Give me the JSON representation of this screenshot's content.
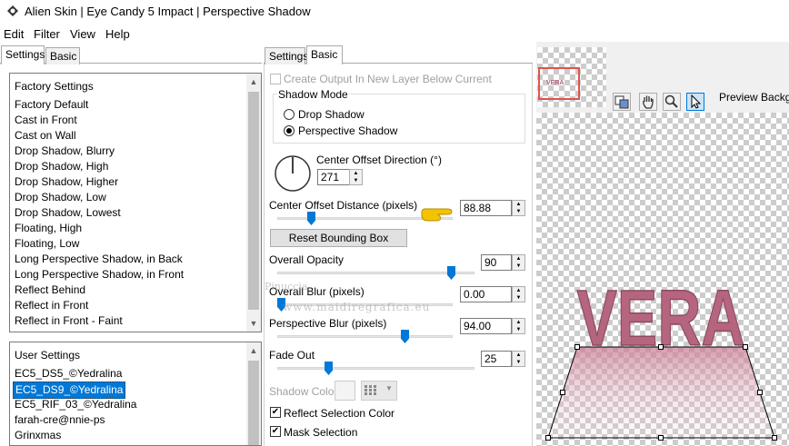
{
  "window": {
    "title": "Alien Skin | Eye Candy 5 Impact | Perspective Shadow"
  },
  "menu": [
    "Edit",
    "Filter",
    "View",
    "Help"
  ],
  "left_tabs": {
    "settings": "Settings",
    "basic": "Basic"
  },
  "factory": {
    "header": "Factory Settings",
    "items": [
      "Factory Default",
      "Cast in Front",
      "Cast on Wall",
      "Drop Shadow, Blurry",
      "Drop Shadow, High",
      "Drop Shadow, Higher",
      "Drop Shadow, Low",
      "Drop Shadow, Lowest",
      "Floating, High",
      "Floating, Low",
      "Long Perspective Shadow, in Back",
      "Long Perspective Shadow, in Front",
      "Reflect Behind",
      "Reflect in Front",
      "Reflect in Front - Faint"
    ]
  },
  "user": {
    "header": "User Settings",
    "items": [
      "EC5_DS5_©Yedralina",
      "EC5_DS9_©Yedralina",
      "EC5_RIF_03_©Yedralina",
      "farah-cre@nnie-ps",
      "Grinxmas"
    ],
    "selected_index": 1
  },
  "mid_tabs": {
    "settings": "Settings",
    "basic": "Basic"
  },
  "controls": {
    "create_output": "Create Output In New Layer Below Current",
    "shadow_mode_label": "Shadow Mode",
    "drop_shadow": "Drop Shadow",
    "perspective_shadow": "Perspective Shadow",
    "shadow_mode_selected": "Perspective Shadow",
    "center_offset_direction_label": "Center Offset Direction (°)",
    "center_offset_direction_value": "271",
    "center_offset_distance_label": "Center Offset Distance (pixels)",
    "center_offset_distance_value": "88.88",
    "center_offset_distance_fraction": 0.18,
    "reset_bounding_box": "Reset Bounding Box",
    "overall_opacity_label": "Overall Opacity",
    "overall_opacity_value": "90",
    "overall_opacity_fraction": 0.9,
    "overall_blur_label": "Overall Blur (pixels)",
    "overall_blur_value": "0.00",
    "overall_blur_fraction": 0.0,
    "perspective_blur_label": "Perspective Blur (pixels)",
    "perspective_blur_value": "94.00",
    "perspective_blur_fraction": 0.74,
    "fade_out_label": "Fade Out",
    "fade_out_value": "25",
    "fade_out_fraction": 0.25,
    "shadow_color_label": "Shadow Color",
    "reflect_selection_color": "Reflect Selection Color",
    "reflect_selection_color_checked": true,
    "mask_selection": "Mask Selection",
    "mask_selection_checked": true
  },
  "preview": {
    "thumb_text": "VERA",
    "background_label": "Preview Backgr",
    "main_text": "VERA",
    "text_color": "#b5667e"
  },
  "watermark": {
    "line1": "Pinuccia",
    "line2": "www.maidiregrafica.eu"
  }
}
